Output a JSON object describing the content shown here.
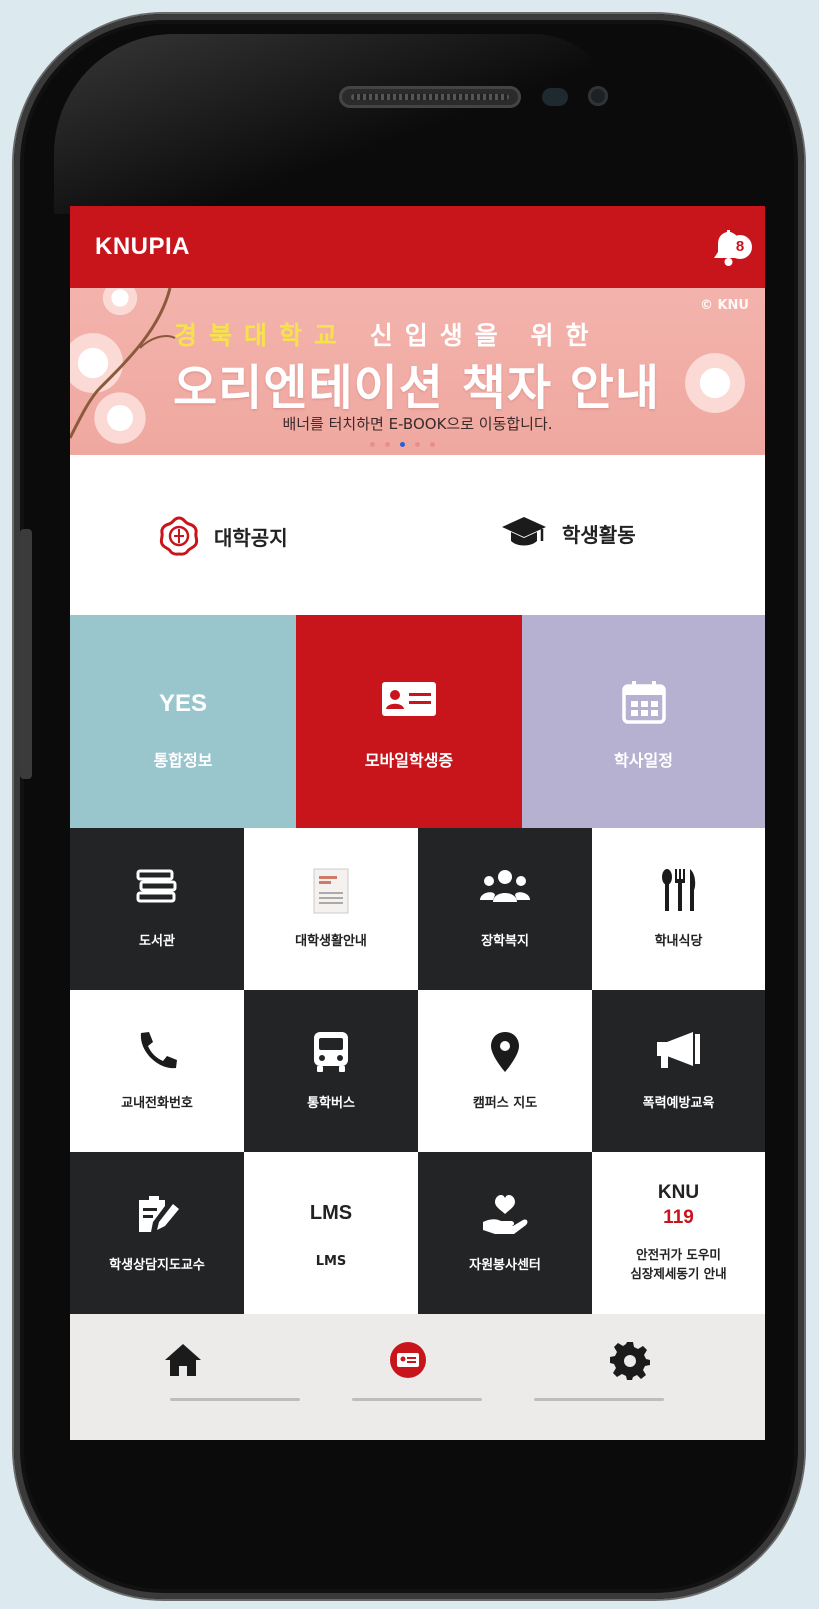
{
  "app": {
    "title": "KNUPIA",
    "notification_count": "8"
  },
  "banner": {
    "logo": "© KNU",
    "line1_highlight": "경북대학교",
    "line1_rest": "신입생을 위한",
    "line2": "오리엔테이션 책자 안내",
    "line3": "배너를 터치하면 E-BOOK으로 이동합니다.",
    "slide_count": 5,
    "active_slide": 2
  },
  "quick_links": [
    {
      "label": "대학공지",
      "icon": "university-seal-icon"
    },
    {
      "label": "학생활동",
      "icon": "graduation-cap-icon"
    }
  ],
  "feature_tiles": [
    {
      "top": "YES",
      "label": "통합정보",
      "color": "#99c5cd"
    },
    {
      "label": "모바일학생증",
      "icon": "id-card-icon",
      "color": "#c8151c"
    },
    {
      "label": "학사일정",
      "icon": "calendar-icon",
      "color": "#b6b0d1"
    }
  ],
  "grid": [
    {
      "label": "도서관",
      "icon": "books-icon"
    },
    {
      "label": "대학생활안내",
      "icon": "guide-book-icon"
    },
    {
      "label": "장학복지",
      "icon": "people-icon"
    },
    {
      "label": "학내식당",
      "icon": "utensils-icon"
    },
    {
      "label": "교내전화번호",
      "icon": "phone-icon"
    },
    {
      "label": "통학버스",
      "icon": "bus-icon"
    },
    {
      "label": "캠퍼스 지도",
      "icon": "map-pin-icon"
    },
    {
      "label": "폭력예방교육",
      "icon": "megaphone-icon"
    },
    {
      "label": "학생상담지도교수",
      "icon": "clipboard-pen-icon"
    },
    {
      "big": "LMS",
      "label": "LMS"
    },
    {
      "label": "자원봉사센터",
      "icon": "hand-heart-icon"
    },
    {
      "big": "KNU",
      "big2": "119",
      "label": "안전귀가 도우미",
      "label2": "심장제세동기 안내"
    }
  ],
  "colors": {
    "brand_red": "#c8151c",
    "dark_tile": "#222426",
    "teal_tile": "#99c5cd",
    "lavender_tile": "#b6b0d1"
  },
  "bottom_nav": [
    {
      "icon": "home-icon"
    },
    {
      "icon": "student-id-icon",
      "active": true
    },
    {
      "icon": "gear-icon"
    }
  ]
}
